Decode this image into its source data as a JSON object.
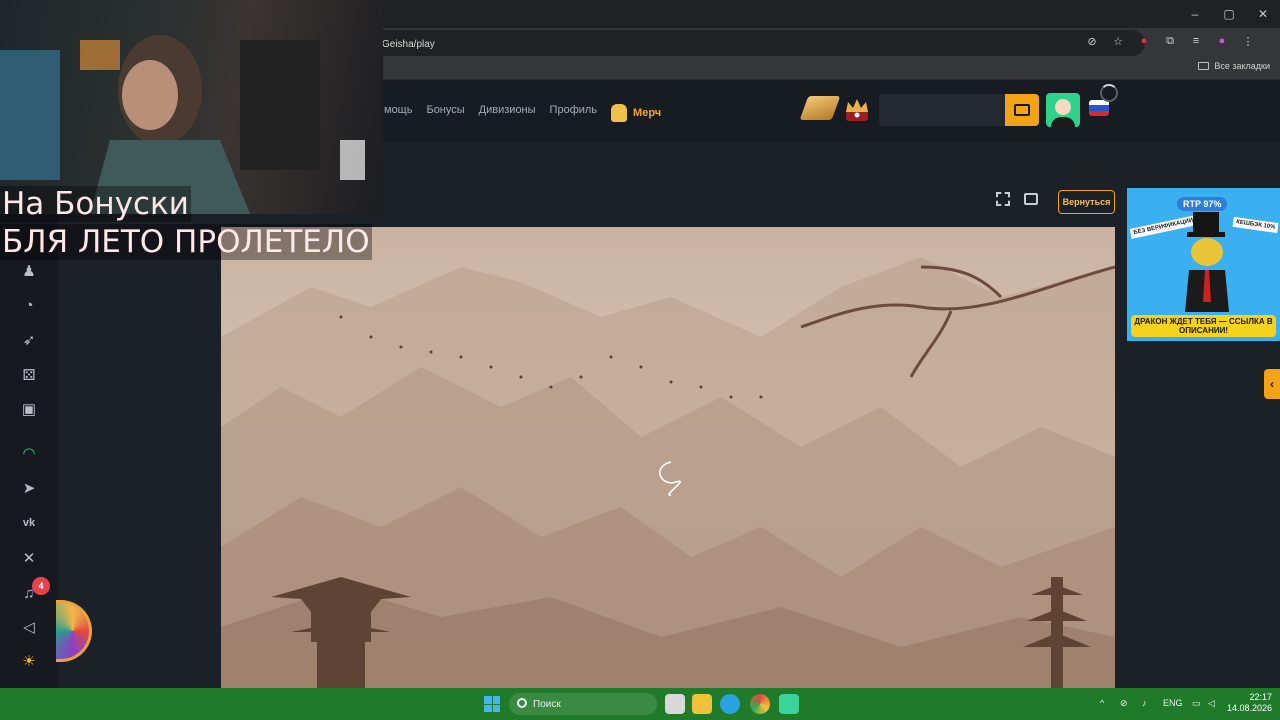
{
  "browser": {
    "url_fragment": "Geisha/play",
    "bookmarks_all_label": "Все закладки",
    "window_controls": [
      "–",
      "▢",
      "✕"
    ]
  },
  "header": {
    "nav_items": [
      "мощь",
      "Бонусы",
      "Дивизионы",
      "Профиль"
    ],
    "merch_label": "Мерч"
  },
  "game_controls": {
    "return_label": "Вернуться"
  },
  "overlay": {
    "line1": "На Бонуски",
    "line2": "БЛЯ ЛЕТО ПРОЛЕТЕЛО"
  },
  "sidebar": {
    "notification_count": "4"
  },
  "promo": {
    "rtp": "RTP 97%",
    "left_tag": "БЕЗ ВЕРИФИКАЦИИ",
    "right_tag": "КЕШБЭК 10%",
    "bottom_text": "ДРАКОН ЖДЕТ ТЕБЯ — ССЫЛКА В ОПИСАНИИ!"
  },
  "taskbar": {
    "search_placeholder": "Поиск",
    "lang": "ENG",
    "time": "22:17",
    "date": "14.08.2026"
  },
  "colors": {
    "accent": "#f2a416",
    "taskbar": "#1f7a2a",
    "game_bg": "#cdb8a7"
  }
}
